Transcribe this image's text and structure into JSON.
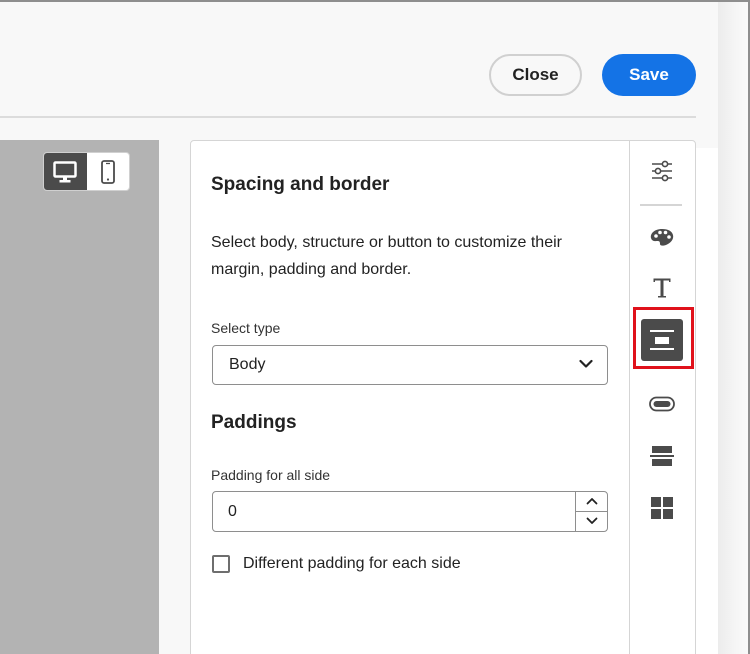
{
  "header": {
    "close_label": "Close",
    "save_label": "Save"
  },
  "device_toggle": {
    "options": [
      "desktop",
      "mobile"
    ],
    "active": "desktop"
  },
  "panel": {
    "title": "Spacing and border",
    "description": "Select body, structure or button to customize their margin, padding and border.",
    "select_type": {
      "label": "Select type",
      "value": "Body"
    },
    "paddings": {
      "title": "Paddings",
      "all_side_label": "Padding for all side",
      "all_side_value": "0",
      "different_checkbox_label": "Different padding for each side",
      "different_checked": false
    }
  },
  "rail": {
    "items": [
      {
        "icon": "settings-sliders-icon"
      },
      {
        "icon": "palette-icon"
      },
      {
        "icon": "text-icon"
      },
      {
        "icon": "spacing-border-icon",
        "active": true
      },
      {
        "icon": "button-icon"
      },
      {
        "icon": "divider-icon"
      },
      {
        "icon": "structure-grid-icon"
      }
    ]
  },
  "colors": {
    "accent": "#1473e6",
    "highlight": "#e0111b",
    "active_rail": "#4b4b4b"
  }
}
